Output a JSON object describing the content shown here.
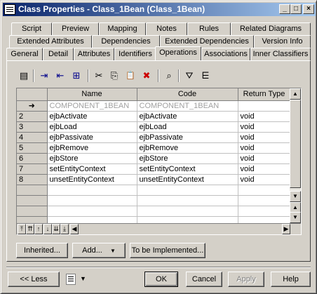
{
  "window": {
    "title": "Class Properties - Class_1Bean (Class_1Bean)",
    "minimize_glyph": "_",
    "maximize_glyph": "□",
    "close_glyph": "×"
  },
  "tabs": {
    "row1": [
      "Script",
      "Preview",
      "Mapping",
      "Notes",
      "Rules",
      "Related Diagrams"
    ],
    "row2": [
      "Extended Attributes",
      "Dependencies",
      "Extended Dependencies",
      "Version Info"
    ],
    "row3": [
      "General",
      "Detail",
      "Attributes",
      "Identifiers",
      "Operations",
      "Associations",
      "Inner Classifiers"
    ],
    "active": "Operations"
  },
  "toolbar": {
    "icons": [
      "properties-icon",
      "insert-row-icon",
      "add-row-icon",
      "add-objects-icon",
      "cut-icon",
      "copy-icon",
      "paste-icon",
      "delete-icon",
      "find-icon",
      "filter-icon",
      "clear-filter-icon"
    ],
    "glyphs": [
      "▤",
      "⇥",
      "⇤",
      "⊞",
      "✂",
      "⎘",
      "📋",
      "✖",
      "⌕",
      "⛛",
      "⋿"
    ]
  },
  "grid": {
    "columns": [
      "Name",
      "Code",
      "Return Type"
    ],
    "rows": [
      {
        "num": "➜",
        "name": "COMPONENT_1BEAN",
        "code": "COMPONENT_1BEAN",
        "type": ""
      },
      {
        "num": "2",
        "name": "ejbActivate",
        "code": "ejbActivate",
        "type": "void"
      },
      {
        "num": "3",
        "name": "ejbLoad",
        "code": "ejbLoad",
        "type": "void"
      },
      {
        "num": "4",
        "name": "ejbPassivate",
        "code": "ejbPassivate",
        "type": "void"
      },
      {
        "num": "5",
        "name": "ejbRemove",
        "code": "ejbRemove",
        "type": "void"
      },
      {
        "num": "6",
        "name": "ejbStore",
        "code": "ejbStore",
        "type": "void"
      },
      {
        "num": "7",
        "name": "setEntityContext",
        "code": "setEntityContext",
        "type": "void"
      },
      {
        "num": "8",
        "name": "unsetEntityContext",
        "code": "unsetEntityContext",
        "type": "void"
      }
    ],
    "scroll_up": "▲",
    "scroll_down": "▼",
    "scroll_left": "◀",
    "scroll_right": "▶",
    "nav_glyphs": [
      "⤒",
      "⇈",
      "↑",
      "↓",
      "⇊",
      "⤓"
    ]
  },
  "panel_buttons": {
    "inherited": "Inherited...",
    "add": "Add...",
    "add_arrow": "▼",
    "to_be_implemented": "To be Implemented..."
  },
  "footer": {
    "less": "<< Less",
    "ok": "OK",
    "cancel": "Cancel",
    "apply": "Apply",
    "help": "Help",
    "menu_arrow": "▼"
  }
}
